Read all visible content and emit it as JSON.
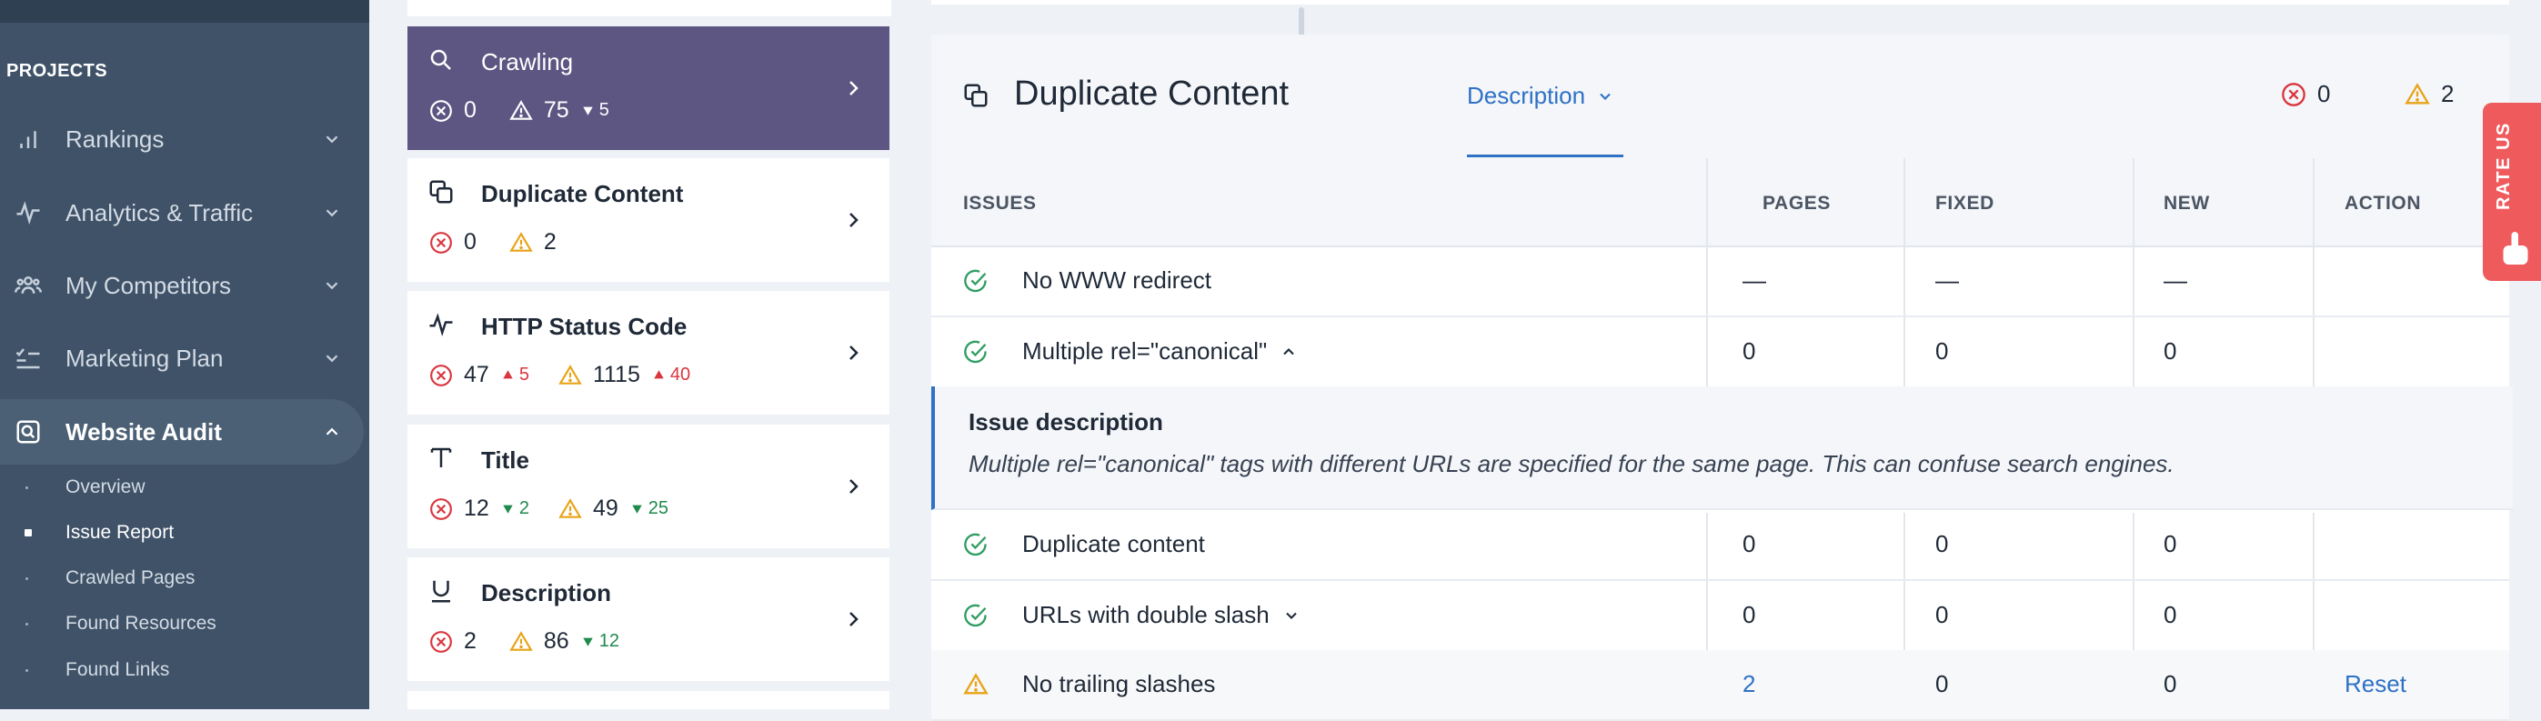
{
  "sidebar": {
    "section_label": "PROJECTS",
    "nav": [
      {
        "label": "Rankings",
        "icon": "bar-chart-icon"
      },
      {
        "label": "Analytics & Traffic",
        "icon": "pulse-icon"
      },
      {
        "label": "My Competitors",
        "icon": "users-icon"
      },
      {
        "label": "Marketing Plan",
        "icon": "checklist-icon"
      },
      {
        "label": "Website Audit",
        "icon": "audit-search-icon"
      }
    ],
    "sub_items": [
      "Overview",
      "Issue Report",
      "Crawled Pages",
      "Found Resources",
      "Found Links"
    ],
    "active_nav": "Website Audit",
    "active_sub": "Issue Report"
  },
  "categories": [
    {
      "title": "Crawling",
      "icon": "search-icon",
      "errors": "0",
      "warnings": "75",
      "warnings_delta": "5",
      "warnings_delta_dir": "down"
    },
    {
      "title": "Duplicate Content",
      "icon": "duplicate-icon",
      "errors": "0",
      "warnings": "2"
    },
    {
      "title": "HTTP Status Code",
      "icon": "pulse-icon",
      "errors": "47",
      "errors_delta": "5",
      "errors_delta_dir": "up",
      "warnings": "1115",
      "warnings_delta": "40",
      "warnings_delta_dir": "up"
    },
    {
      "title": "Title",
      "icon": "text-t-icon",
      "errors": "12",
      "errors_delta": "2",
      "errors_delta_dir": "down",
      "warnings": "49",
      "warnings_delta": "25",
      "warnings_delta_dir": "down"
    },
    {
      "title": "Description",
      "icon": "underline-icon",
      "errors": "2",
      "warnings": "86",
      "warnings_delta": "12",
      "warnings_delta_dir": "down"
    }
  ],
  "panel": {
    "title": "Duplicate Content",
    "description_tab": "Description",
    "errors": "0",
    "warnings": "2"
  },
  "table": {
    "headers": {
      "issues": "ISSUES",
      "pages": "PAGES",
      "fixed": "FIXED",
      "new": "NEW",
      "action": "ACTION"
    },
    "rows": [
      {
        "label": "No WWW redirect",
        "status": "ok",
        "pages": "—",
        "fixed": "—",
        "new": "—",
        "action": ""
      },
      {
        "label": "Multiple rel=\"canonical\"",
        "status": "ok",
        "pages": "0",
        "fixed": "0",
        "new": "0",
        "action": "",
        "expanded": true
      },
      {
        "label": "Duplicate content",
        "status": "ok",
        "pages": "0",
        "fixed": "0",
        "new": "0",
        "action": ""
      },
      {
        "label": "URLs with double slash",
        "status": "ok",
        "pages": "0",
        "fixed": "0",
        "new": "0",
        "action": ""
      },
      {
        "label": "No trailing slashes",
        "status": "warning",
        "pages": "2",
        "fixed": "0",
        "new": "0",
        "action": "Reset"
      }
    ],
    "issue_description": {
      "heading": "Issue description",
      "text": "Multiple rel=\"canonical\" tags with different URLs are specified for the same page. This can confuse search engines."
    }
  },
  "rate_us": {
    "label": "RATE US"
  },
  "colors": {
    "sidebar_bg": "#3f5267",
    "active_category": "#5d5682",
    "link_blue": "#2e71c5",
    "error_red": "#d9363e",
    "warning_amber": "#e8a317",
    "ok_green": "#2f9e62",
    "rate_us_red": "#ef5a5d"
  }
}
